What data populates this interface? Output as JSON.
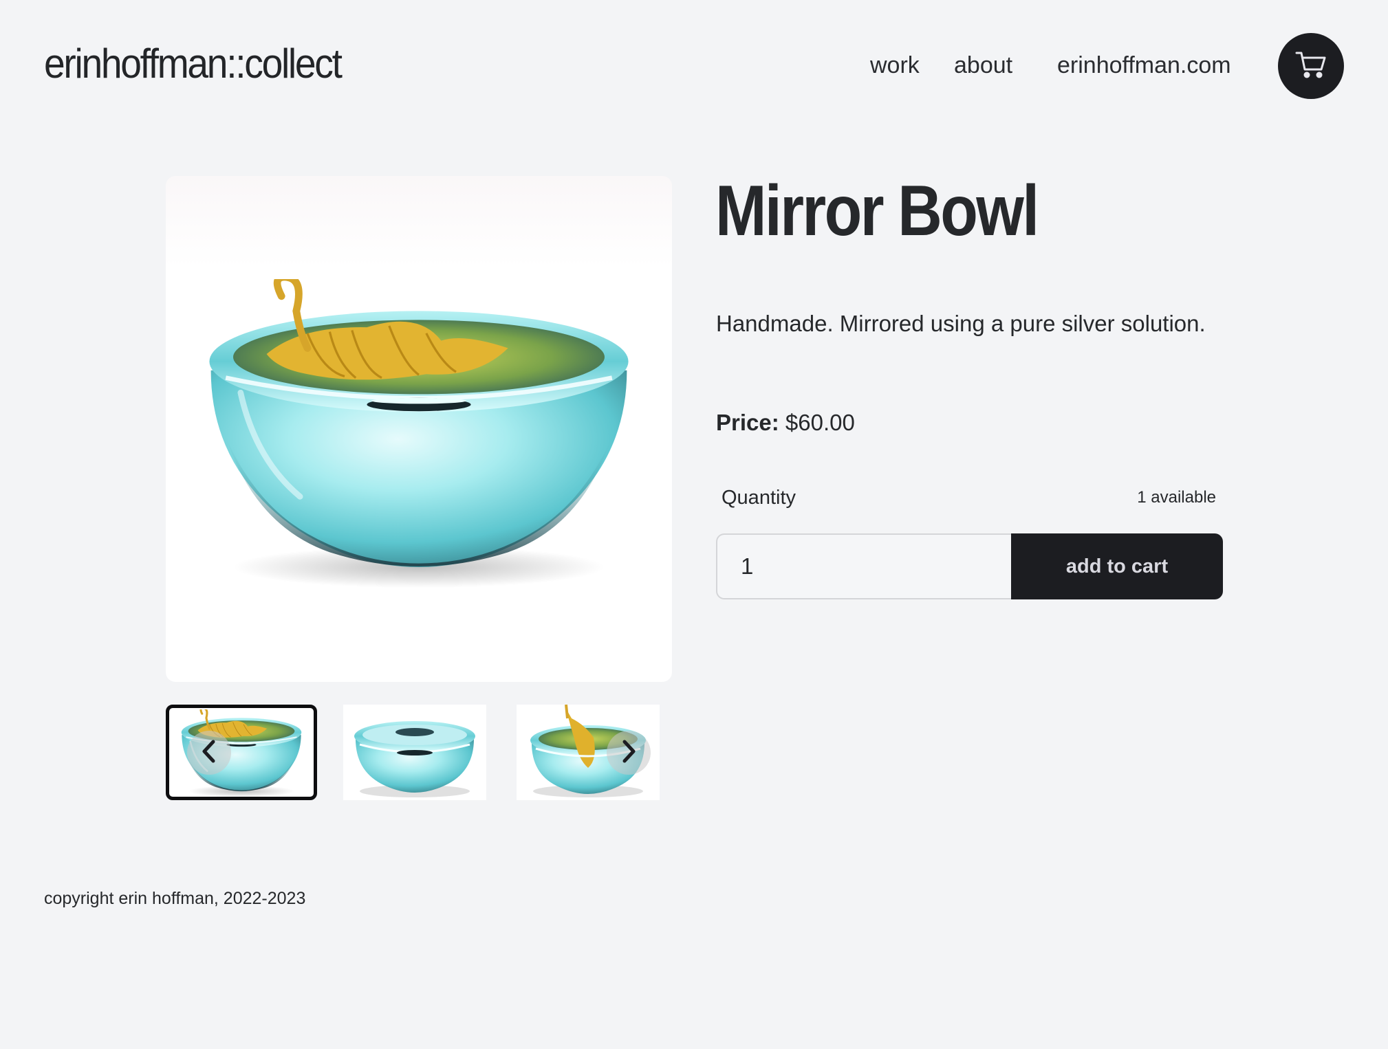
{
  "header": {
    "site_title": "erinhoffman::collect",
    "nav": {
      "work": "work",
      "about": "about",
      "home_link": "erinhoffman.com"
    },
    "cart_icon": "shopping-cart-icon"
  },
  "product": {
    "title": "Mirror Bowl",
    "description": "Handmade. Mirrored using a pure silver solution.",
    "price_label": "Price:",
    "price_value": "$60.00",
    "quantity_label": "Quantity",
    "available_text": "1 available",
    "quantity_value": "1",
    "add_to_cart_label": "add to cart"
  },
  "gallery": {
    "selected_index": 0,
    "thumbnail_count": 3,
    "prev_icon": "chevron-left-icon",
    "next_icon": "chevron-right-icon"
  },
  "footer": {
    "copyright": "copyright erin hoffman, 2022-2023"
  },
  "colors": {
    "background": "#f3f4f6",
    "dark": "#1c1d21",
    "bowl_teal": "#7fd9e0",
    "tassel_gold": "#d9a61c"
  }
}
